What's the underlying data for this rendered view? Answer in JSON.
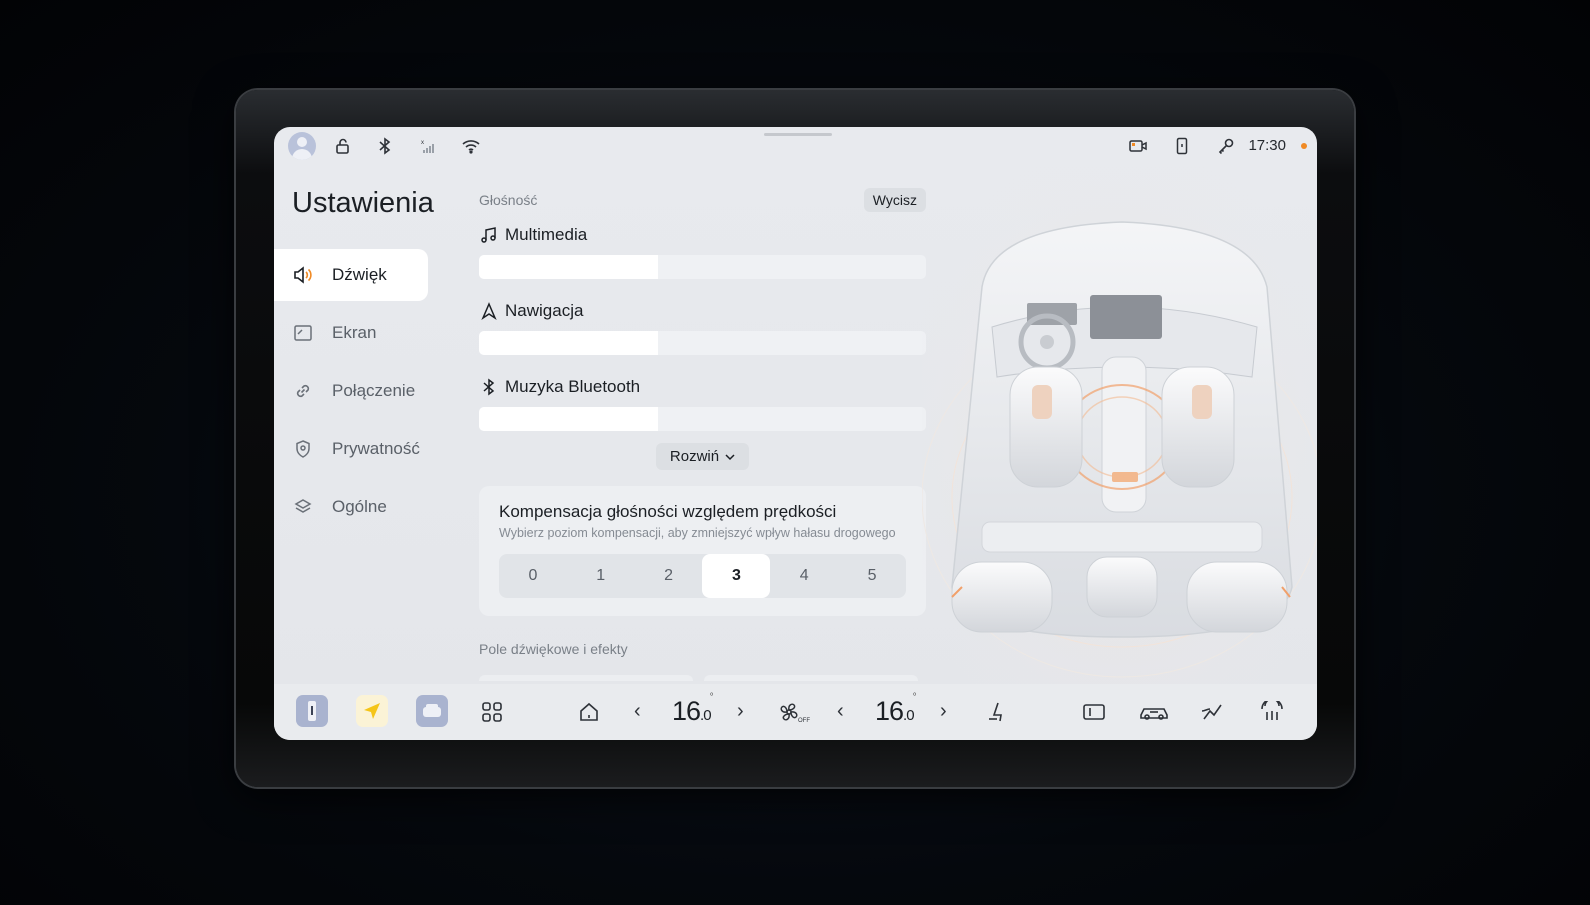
{
  "status_bar": {
    "time": "17:30",
    "icons": [
      "avatar",
      "lock-open-icon",
      "bluetooth-icon",
      "cellular-signal-icon",
      "wifi-icon",
      "camera-record-icon",
      "phone-device-icon",
      "key-icon"
    ],
    "notification_color": "#f08a24"
  },
  "sidebar": {
    "title": "Ustawienia",
    "items": [
      {
        "label": "Dźwięk",
        "icon": "speaker-icon",
        "active": true
      },
      {
        "label": "Ekran",
        "icon": "display-icon",
        "active": false
      },
      {
        "label": "Połączenie",
        "icon": "link-icon",
        "active": false
      },
      {
        "label": "Prywatność",
        "icon": "shield-icon",
        "active": false
      },
      {
        "label": "Ogólne",
        "icon": "layers-icon",
        "active": false
      }
    ]
  },
  "volume": {
    "section_label": "Głośność",
    "mute_label": "Wycisz",
    "channels": [
      {
        "label": "Multimedia",
        "icon": "music-note-icon",
        "level": 0.4
      },
      {
        "label": "Nawigacja",
        "icon": "navigation-arrow-icon",
        "level": 0.4
      },
      {
        "label": "Muzyka Bluetooth",
        "icon": "bluetooth-icon",
        "level": 0.4
      }
    ],
    "expand_label": "Rozwiń"
  },
  "compensation": {
    "title": "Kompensacja głośności względem prędkości",
    "subtitle": "Wybierz poziom kompensacji, aby zmniejszyć wpływ hałasu drogowego",
    "options": [
      "0",
      "1",
      "2",
      "3",
      "4",
      "5"
    ],
    "selected": "3"
  },
  "sound_field": {
    "section_label": "Pole dźwiękowe i efekty"
  },
  "dock": {
    "left_temp": {
      "whole": "16",
      "decimal": "0",
      "degree": "°"
    },
    "right_temp": {
      "whole": "16",
      "decimal": "0",
      "degree": "°"
    },
    "fan_label": "OFF",
    "accent_color": "#f5c518"
  }
}
